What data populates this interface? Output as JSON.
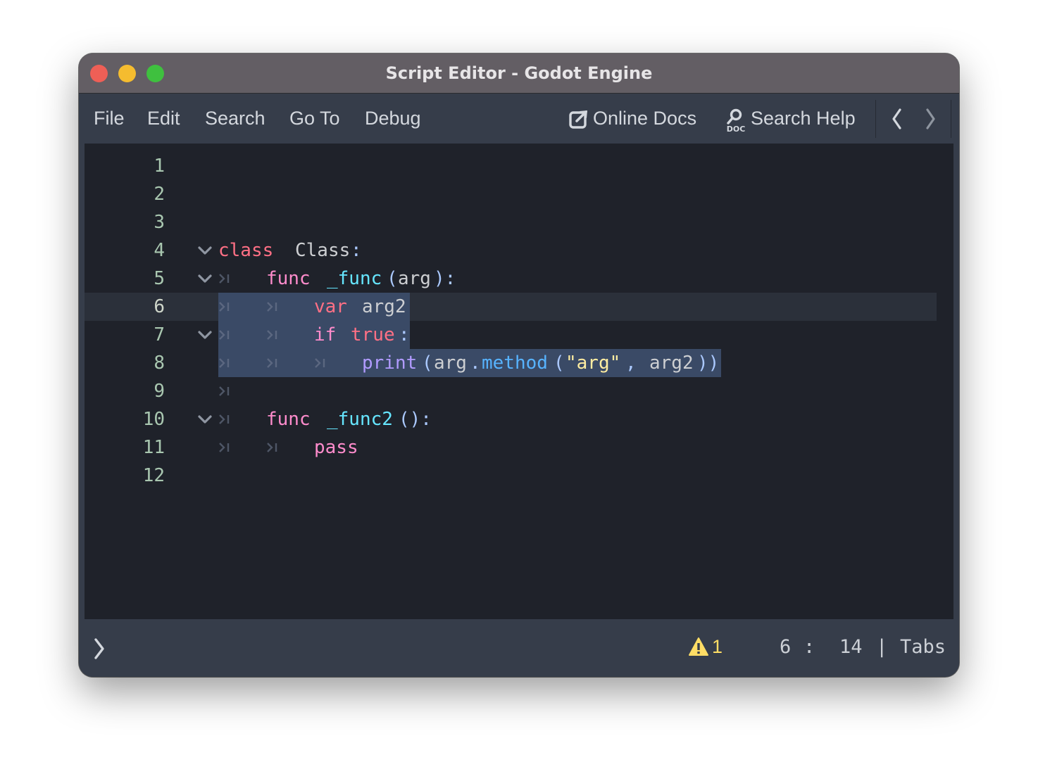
{
  "window": {
    "title": "Script Editor - Godot Engine"
  },
  "menu": {
    "items": [
      "File",
      "Edit",
      "Search",
      "Go To",
      "Debug"
    ],
    "online_docs": "Online Docs",
    "search_help": "Search Help"
  },
  "editor": {
    "line_numbers": [
      "1",
      "2",
      "3",
      "4",
      "5",
      "6",
      "7",
      "8",
      "9",
      "10",
      "11",
      "12"
    ],
    "current_line": 6,
    "code": {
      "l4": {
        "kw": "class",
        "name": "Class",
        "colon": ":"
      },
      "l5": {
        "kw": "func",
        "name": "_func",
        "open": "(",
        "arg": "arg",
        "close": "):"
      },
      "l6": {
        "kw": "var",
        "name": "arg2"
      },
      "l7": {
        "kw": "if",
        "val": "true",
        "colon": ":"
      },
      "l8": {
        "fn": "print",
        "p1": "(",
        "obj": "arg",
        "dot": ".",
        "meth": "method",
        "p2": "(",
        "str": "\"arg\"",
        "comma": ",",
        "arg": "arg2",
        "p3": "))"
      },
      "l10": {
        "kw": "func",
        "name": "_func2",
        "parens": "():"
      },
      "l11": {
        "kw": "pass"
      }
    }
  },
  "status": {
    "warnings": "1",
    "line": "6",
    "col_sep": ":",
    "column": "14",
    "bar": "|",
    "indent": "Tabs"
  },
  "colors": {
    "keyword": "#ff7085",
    "control_flow": "#ff8ccc",
    "function": "#66e6ff",
    "string": "#ffeda1",
    "selection": "#3a4a66",
    "warning": "#ffdd65"
  }
}
